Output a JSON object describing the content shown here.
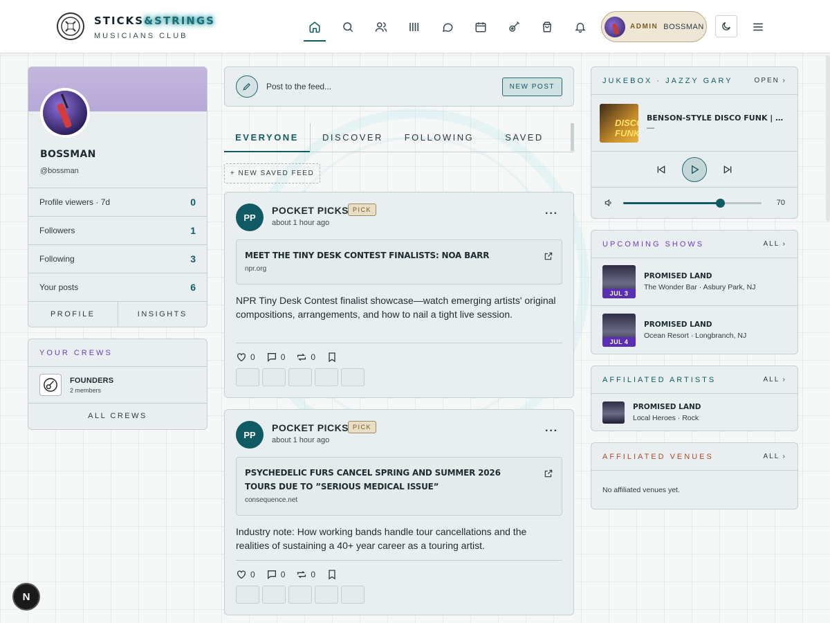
{
  "brand": {
    "title_main": "STICKS",
    "title_amp": "&STRINGS",
    "subtitle": "MUSICIANS CLUB"
  },
  "nav": {
    "icons": [
      "home-icon",
      "search-icon",
      "users-icon",
      "music-bars-icon",
      "chat-icon",
      "calendar-icon",
      "guitar-icon",
      "shopping-bag-icon",
      "bell-icon"
    ]
  },
  "admin": {
    "tag": "ADMIN",
    "name": "BOSSMAN"
  },
  "profile": {
    "name": "BOSSMAN",
    "handle": "@bossman",
    "stats": [
      {
        "label": "Profile viewers · 7d",
        "value": "0"
      },
      {
        "label": "Followers",
        "value": "1"
      },
      {
        "label": "Following",
        "value": "3"
      },
      {
        "label": "Your posts",
        "value": "6"
      }
    ],
    "actions": [
      "PROFILE",
      "INSIGHTS"
    ]
  },
  "crews": {
    "title": "YOUR CREWS",
    "items": [
      {
        "name": "FOUNDERS",
        "members": "2 members"
      }
    ],
    "all_label": "ALL CREWS"
  },
  "composer": {
    "placeholder": "Post to the feed...",
    "button": "NEW POST"
  },
  "tabs": [
    "EVERYONE",
    "DISCOVER",
    "FOLLOWING",
    "SAVED"
  ],
  "new_feed_label": "+ NEW SAVED FEED",
  "posts": [
    {
      "initials": "PP",
      "author": "POCKET PICKS",
      "badge": "PICK",
      "time": "about 1 hour ago",
      "link_title": "MEET THE TINY DESK CONTEST FINALISTS: NOA BARR",
      "link_domain": "npr.org",
      "body": "NPR Tiny Desk Contest finalist showcase—watch emerging artists' original compositions, arrangements, and how to nail a tight live session.",
      "likes": "0",
      "comments": "0",
      "reposts": "0"
    },
    {
      "initials": "PP",
      "author": "POCKET PICKS",
      "badge": "PICK",
      "time": "about 1 hour ago",
      "link_title": "PSYCHEDELIC FURS CANCEL SPRING AND SUMMER 2026 TOURS DUE TO ”SERIOUS MEDICAL ISSUE”",
      "link_domain": "consequence.net",
      "body": "Industry note: How working bands handle tour cancellations and the realities of sustaining a 40+ year career as a touring artist.",
      "likes": "0",
      "comments": "0",
      "reposts": "0"
    }
  ],
  "jukebox": {
    "title": "JUKEBOX · JAZZY GARY",
    "open_label": "OPEN",
    "cover_text": "DISCO FUNK",
    "track_title": "BENSON-STYLE DISCO FUNK | SMOOTH JAZZ GUITAR",
    "track_sub": "—",
    "volume": 70,
    "volume_label": "70"
  },
  "shows": {
    "title": "UPCOMING SHOWS",
    "all_label": "ALL",
    "items": [
      {
        "date": "JUL 3",
        "name": "PROMISED LAND",
        "place": "The Wonder Bar · Asbury Park, NJ"
      },
      {
        "date": "JUL 4",
        "name": "PROMISED LAND",
        "place": "Ocean Resort · Longbranch, NJ"
      }
    ]
  },
  "artists": {
    "title": "AFFILIATED ARTISTS",
    "all_label": "ALL",
    "items": [
      {
        "name": "PROMISED LAND",
        "meta": "Local Heroes · Rock"
      }
    ]
  },
  "venues": {
    "title": "AFFILIATED VENUES",
    "all_label": "ALL",
    "empty": "No affiliated venues yet."
  },
  "colors": {
    "accent": "#0f5a63",
    "shows_title": "#6a3fc4",
    "crews_title": "#6a3fc4",
    "venues_title": "#b04a2a",
    "badge_bg": "#e8ddc7"
  }
}
